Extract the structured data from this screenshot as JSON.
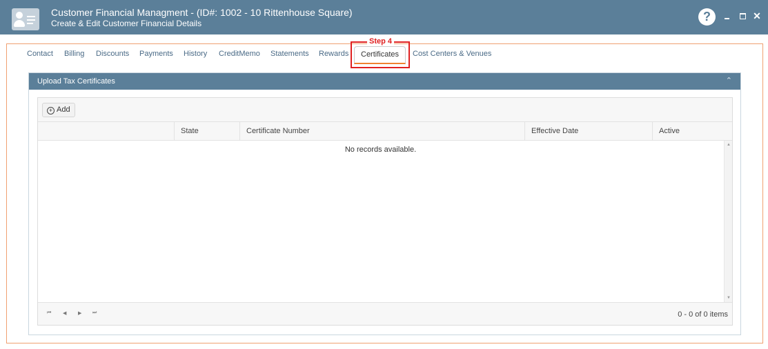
{
  "window": {
    "title": "Customer Financial Managment - (ID#: 1002 - 10 Rittenhouse Square)",
    "subtitle": "Create & Edit Customer Financial Details",
    "help_symbol": "?",
    "close_symbol": "✕"
  },
  "tabs": [
    {
      "label": "Contact"
    },
    {
      "label": "Billing"
    },
    {
      "label": "Discounts"
    },
    {
      "label": "Payments"
    },
    {
      "label": "History"
    },
    {
      "label": "CreditMemo"
    },
    {
      "label": "Statements"
    },
    {
      "label": "Rewards"
    },
    {
      "label": "Certificates",
      "active": true
    },
    {
      "label": "Cost Centers & Venues"
    }
  ],
  "annotation": {
    "step_label": "Step 4",
    "color": "#e02020"
  },
  "panel": {
    "title": "Upload Tax Certificates",
    "collapse_symbol": "⌃",
    "add_label": "Add",
    "columns": [
      "",
      "State",
      "Certificate Number",
      "Effective Date",
      "Active"
    ],
    "empty_message": "No records available.",
    "pager_buttons": [
      "⏮",
      "◀",
      "▶",
      "⏭"
    ],
    "pager_info": "0 - 0 of 0 items"
  },
  "colors": {
    "header": "#5b7f99",
    "accent": "#f08030",
    "frame": "#f0a070"
  }
}
